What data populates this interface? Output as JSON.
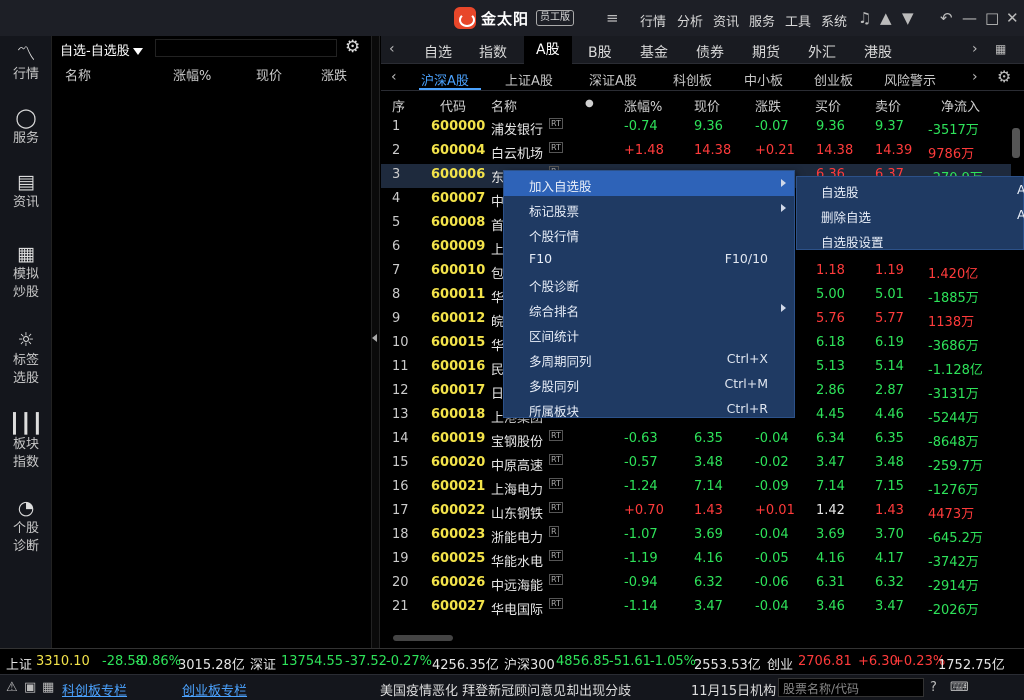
{
  "titlebar": {
    "brand": "金太阳",
    "badge": "员工版",
    "menu": [
      "行情",
      "分析",
      "资讯",
      "服务",
      "工具",
      "系统"
    ]
  },
  "sidebar": {
    "items": [
      {
        "icon": "line-chart-icon",
        "label1": "行情",
        "label2": ""
      },
      {
        "icon": "person-icon",
        "label1": "服务",
        "label2": ""
      },
      {
        "icon": "news-icon",
        "label1": "资讯",
        "label2": ""
      },
      {
        "icon": "keyboard-icon",
        "label1": "模拟",
        "label2": "炒股"
      },
      {
        "icon": "lightbulb-icon",
        "label1": "标签",
        "label2": "选股"
      },
      {
        "icon": "bar-chart-icon",
        "label1": "板块",
        "label2": "指数"
      },
      {
        "icon": "gauge-icon",
        "label1": "个股",
        "label2": "诊断"
      }
    ]
  },
  "watchlist": {
    "title": "自选-自选股",
    "columns": [
      "名称",
      "涨幅%",
      "现价",
      "涨跌"
    ]
  },
  "market": {
    "tabs": [
      "自选",
      "指数",
      "A股",
      "B股",
      "基金",
      "债券",
      "期货",
      "外汇",
      "港股"
    ],
    "active_tab": "A股",
    "subtabs": [
      "沪深A股",
      "上证A股",
      "深证A股",
      "科创板",
      "中小板",
      "创业板",
      "风险警示"
    ],
    "columns": [
      "序",
      "代码",
      "名称",
      "●",
      "涨幅%",
      "现价",
      "涨跌",
      "买价",
      "卖价",
      "净流入"
    ],
    "rows": [
      {
        "i": "1",
        "code": "600000",
        "name": "浦发银行",
        "tag": "RT",
        "chg": "-0.74",
        "price": "9.36",
        "diff": "-0.07",
        "bid": "9.36",
        "ask": "9.37",
        "flow": "-3517万",
        "dir": "dn",
        "bdir": "dn",
        "adir": "dn",
        "fdir": "dn"
      },
      {
        "i": "2",
        "code": "600004",
        "name": "白云机场",
        "tag": "RT",
        "chg": "+1.48",
        "price": "14.38",
        "diff": "+0.21",
        "bid": "14.38",
        "ask": "14.39",
        "flow": "9786万",
        "dir": "up",
        "bdir": "up",
        "adir": "up",
        "fdir": "up"
      },
      {
        "i": "3",
        "code": "600006",
        "name": "东风汽车",
        "tag": "R",
        "chg": "",
        "price": "",
        "diff": "",
        "bid": "6.36",
        "ask": "6.37",
        "flow": "-270.9万",
        "dir": "up",
        "bdir": "up",
        "adir": "up",
        "fdir": "dn"
      },
      {
        "i": "4",
        "code": "600007",
        "name": "中国国贸",
        "tag": "",
        "chg": "",
        "price": "",
        "diff": "",
        "bid": "",
        "ask": "",
        "flow": "",
        "dir": "up",
        "bdir": "up",
        "adir": "up",
        "fdir": "up"
      },
      {
        "i": "5",
        "code": "600008",
        "name": "首创股份",
        "tag": "",
        "chg": "",
        "price": "",
        "diff": "",
        "bid": "",
        "ask": "",
        "flow": "",
        "dir": "up",
        "bdir": "up",
        "adir": "up",
        "fdir": "up"
      },
      {
        "i": "6",
        "code": "600009",
        "name": "上海机场",
        "tag": "",
        "chg": "",
        "price": "",
        "diff": "",
        "bid": "",
        "ask": "",
        "flow": "",
        "dir": "up",
        "bdir": "up",
        "adir": "up",
        "fdir": "up"
      },
      {
        "i": "7",
        "code": "600010",
        "name": "包钢股份",
        "tag": "",
        "chg": "",
        "price": "",
        "diff": "",
        "bid": "1.18",
        "ask": "1.19",
        "flow": "1.420亿",
        "dir": "up",
        "bdir": "up",
        "adir": "up",
        "fdir": "up"
      },
      {
        "i": "8",
        "code": "600011",
        "name": "华能国际",
        "tag": "",
        "chg": "",
        "price": "",
        "diff": "",
        "bid": "5.00",
        "ask": "5.01",
        "flow": "-1885万",
        "dir": "dn",
        "bdir": "dn",
        "adir": "dn",
        "fdir": "dn"
      },
      {
        "i": "9",
        "code": "600012",
        "name": "皖通高速",
        "tag": "",
        "chg": "",
        "price": "",
        "diff": "",
        "bid": "5.76",
        "ask": "5.77",
        "flow": "1138万",
        "dir": "up",
        "bdir": "up",
        "adir": "up",
        "fdir": "up"
      },
      {
        "i": "10",
        "code": "600015",
        "name": "华夏银行",
        "tag": "",
        "chg": "",
        "price": "",
        "diff": "",
        "bid": "6.18",
        "ask": "6.19",
        "flow": "-3686万",
        "dir": "dn",
        "bdir": "dn",
        "adir": "dn",
        "fdir": "dn"
      },
      {
        "i": "11",
        "code": "600016",
        "name": "民生银行",
        "tag": "",
        "chg": "",
        "price": "",
        "diff": "",
        "bid": "5.13",
        "ask": "5.14",
        "flow": "-1.128亿",
        "dir": "dn",
        "bdir": "dn",
        "adir": "dn",
        "fdir": "dn"
      },
      {
        "i": "12",
        "code": "600017",
        "name": "日照港",
        "tag": "",
        "chg": "",
        "price": "",
        "diff": "",
        "bid": "2.86",
        "ask": "2.87",
        "flow": "-3131万",
        "dir": "dn",
        "bdir": "dn",
        "adir": "dn",
        "fdir": "dn"
      },
      {
        "i": "13",
        "code": "600018",
        "name": "上港集团",
        "tag": "",
        "chg": "",
        "price": "",
        "diff": "",
        "bid": "4.45",
        "ask": "4.46",
        "flow": "-5244万",
        "dir": "dn",
        "bdir": "dn",
        "adir": "dn",
        "fdir": "dn"
      },
      {
        "i": "14",
        "code": "600019",
        "name": "宝钢股份",
        "tag": "RT",
        "chg": "-0.63",
        "price": "6.35",
        "diff": "-0.04",
        "bid": "6.34",
        "ask": "6.35",
        "flow": "-8648万",
        "dir": "dn",
        "bdir": "dn",
        "adir": "dn",
        "fdir": "dn"
      },
      {
        "i": "15",
        "code": "600020",
        "name": "中原高速",
        "tag": "RT",
        "chg": "-0.57",
        "price": "3.48",
        "diff": "-0.02",
        "bid": "3.47",
        "ask": "3.48",
        "flow": "-259.7万",
        "dir": "dn",
        "bdir": "dn",
        "adir": "dn",
        "fdir": "dn"
      },
      {
        "i": "16",
        "code": "600021",
        "name": "上海电力",
        "tag": "RT",
        "chg": "-1.24",
        "price": "7.14",
        "diff": "-0.09",
        "bid": "7.14",
        "ask": "7.15",
        "flow": "-1276万",
        "dir": "dn",
        "bdir": "dn",
        "adir": "dn",
        "fdir": "dn"
      },
      {
        "i": "17",
        "code": "600022",
        "name": "山东钢铁",
        "tag": "RT",
        "chg": "+0.70",
        "price": "1.43",
        "diff": "+0.01",
        "bid": "1.42",
        "ask": "1.43",
        "flow": "4473万",
        "dir": "up",
        "bdir": "fl",
        "adir": "up",
        "fdir": "up"
      },
      {
        "i": "18",
        "code": "600023",
        "name": "浙能电力",
        "tag": "R",
        "chg": "-1.07",
        "price": "3.69",
        "diff": "-0.04",
        "bid": "3.69",
        "ask": "3.70",
        "flow": "-645.2万",
        "dir": "dn",
        "bdir": "dn",
        "adir": "dn",
        "fdir": "dn"
      },
      {
        "i": "19",
        "code": "600025",
        "name": "华能水电",
        "tag": "RT",
        "chg": "-1.19",
        "price": "4.16",
        "diff": "-0.05",
        "bid": "4.16",
        "ask": "4.17",
        "flow": "-3742万",
        "dir": "dn",
        "bdir": "dn",
        "adir": "dn",
        "fdir": "dn"
      },
      {
        "i": "20",
        "code": "600026",
        "name": "中远海能",
        "tag": "RT",
        "chg": "-0.94",
        "price": "6.32",
        "diff": "-0.06",
        "bid": "6.31",
        "ask": "6.32",
        "flow": "-2914万",
        "dir": "dn",
        "bdir": "dn",
        "adir": "dn",
        "fdir": "dn"
      },
      {
        "i": "21",
        "code": "600027",
        "name": "华电国际",
        "tag": "RT",
        "chg": "-1.14",
        "price": "3.47",
        "diff": "-0.04",
        "bid": "3.46",
        "ask": "3.47",
        "flow": "-2026万",
        "dir": "dn",
        "bdir": "dn",
        "adir": "dn",
        "fdir": "dn"
      }
    ]
  },
  "context_menu": {
    "items": [
      {
        "label": "加入自选股",
        "shortcut": "",
        "submenu": true
      },
      {
        "label": "标记股票",
        "shortcut": "",
        "submenu": true
      },
      {
        "label": "个股行情",
        "shortcut": "",
        "submenu": false
      },
      {
        "label": "F10",
        "shortcut": "F10/10",
        "submenu": false
      },
      {
        "label": "个股诊断",
        "shortcut": "",
        "submenu": false
      },
      {
        "label": "综合排名",
        "shortcut": "",
        "submenu": true
      },
      {
        "label": "区间统计",
        "shortcut": "",
        "submenu": false
      },
      {
        "label": "多周期同列",
        "shortcut": "Ctrl+X",
        "submenu": false
      },
      {
        "label": "多股同列",
        "shortcut": "Ctrl+M",
        "submenu": false
      },
      {
        "label": "所属板块",
        "shortcut": "Ctrl+R",
        "submenu": false
      }
    ],
    "submenu": [
      {
        "label": "自选股",
        "shortcut": "A"
      },
      {
        "label": "删除自选",
        "shortcut": "A"
      },
      {
        "label": "自选股设置",
        "shortcut": ""
      }
    ]
  },
  "ticker": {
    "sh_label": "上证",
    "sh_val": "3310.10",
    "sh_chg": "-28.58",
    "sh_pct": "-0.86%",
    "sh_amt": "3015.28亿",
    "sz_label": "深证",
    "sz_val": "13754.55",
    "sz_chg": "-37.52",
    "sz_pct": "-0.27%",
    "sz_amt": "4256.35亿",
    "hs_label": "沪深300",
    "hs_val": "4856.85",
    "hs_chg": "-51.61",
    "hs_pct": "-1.05%",
    "hs_amt": "2553.53亿",
    "cy_label": "创业",
    "cy_val": "2706.81",
    "cy_chg": "+6.30",
    "cy_pct": "+0.23%",
    "cy_amt": "1752.75亿"
  },
  "bottombar": {
    "link1": "科创板专栏",
    "link2": "创业板专栏",
    "news": "美国疫情恶化 拜登新冠顾问意见却出现分歧",
    "date": "11月15日机构",
    "search_placeholder": "股票名称/代码"
  },
  "colors": {
    "up": "#ff3b3b",
    "down": "#2ee35a",
    "code": "#f3e34a",
    "accent": "#4ba3ff",
    "menu_bg": "#1f3a63",
    "menu_highlight": "#2e63b8"
  }
}
